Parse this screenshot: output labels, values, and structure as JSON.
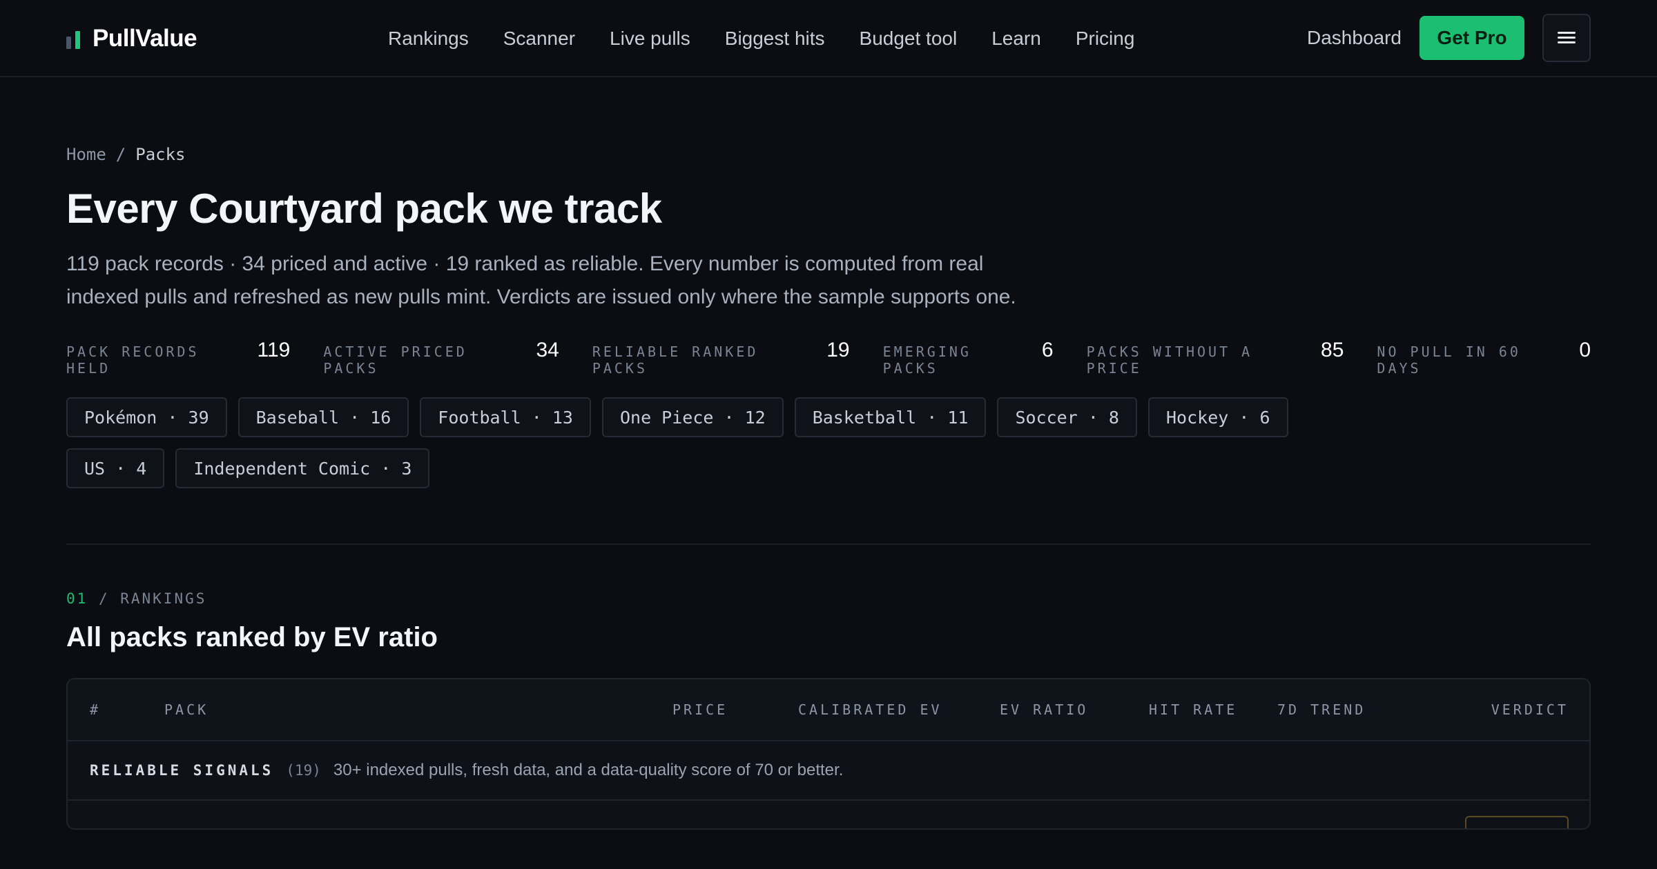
{
  "brand": {
    "name": "PullValue"
  },
  "nav": {
    "items": [
      "Rankings",
      "Scanner",
      "Live pulls",
      "Biggest hits",
      "Budget tool",
      "Learn",
      "Pricing"
    ]
  },
  "header_right": {
    "dashboard": "Dashboard",
    "get_pro": "Get Pro",
    "menu_icon": "hamburger-menu-icon"
  },
  "breadcrumb": {
    "home": "Home",
    "separator": "/",
    "current": "Packs"
  },
  "page": {
    "title": "Every Courtyard pack we track",
    "description": "119 pack records · 34 priced and active · 19 ranked as reliable. Every number is computed from real indexed pulls and refreshed as new pulls mint. Verdicts are issued only where the sample supports one."
  },
  "stats": [
    {
      "label": "PACK RECORDS HELD",
      "value": "119"
    },
    {
      "label": "ACTIVE PRICED PACKS",
      "value": "34"
    },
    {
      "label": "RELIABLE RANKED PACKS",
      "value": "19"
    },
    {
      "label": "EMERGING PACKS",
      "value": "6"
    },
    {
      "label": "PACKS WITHOUT A PRICE",
      "value": "85"
    },
    {
      "label": "NO PULL IN 60 DAYS",
      "value": "0"
    }
  ],
  "categories": [
    "Pokémon · 39",
    "Baseball · 16",
    "Football · 13",
    "One Piece · 12",
    "Basketball · 11",
    "Soccer · 8",
    "Hockey · 6",
    "US · 4",
    "Independent Comic · 3"
  ],
  "rankings": {
    "eyebrow_num": "01",
    "eyebrow_sep": " / ",
    "eyebrow_label": "RANKINGS",
    "title": "All packs ranked by EV ratio",
    "columns": {
      "rank": "#",
      "pack": "PACK",
      "price": "PRICE",
      "calibrated_ev": "CALIBRATED EV",
      "ev_ratio": "EV RATIO",
      "hit_rate": "HIT RATE",
      "trend": "7D TREND",
      "verdict": "VERDICT"
    },
    "group": {
      "label": "RELIABLE SIGNALS",
      "count": "(19)",
      "description": "30+ indexed pulls, fresh data, and a data-quality score of 70 or better."
    }
  },
  "colors": {
    "background": "#0b0d12",
    "accent": "#1cbf72",
    "text_muted": "#8d96a6"
  }
}
